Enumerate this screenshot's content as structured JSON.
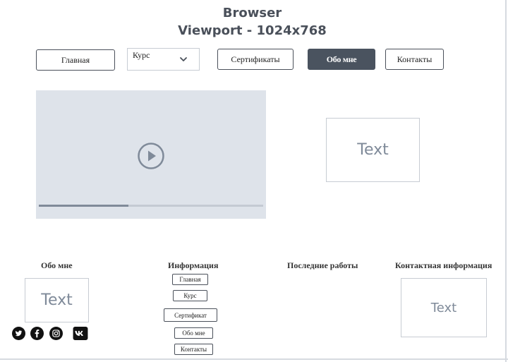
{
  "header": {
    "line1": "Browser",
    "line2": "Viewport - 1024x768"
  },
  "nav": {
    "home": "Главная",
    "course": "Курс",
    "certificates": "Сертификаты",
    "about": "Обо мне",
    "contacts": "Контакты",
    "active": "about"
  },
  "video": {
    "progress": 0.4
  },
  "main_text_box": "Text",
  "footer": {
    "about": {
      "heading": "Обо мне",
      "text_box": "Text",
      "social": [
        "twitter-icon",
        "facebook-icon",
        "instagram-icon",
        "vk-icon"
      ]
    },
    "info": {
      "heading": "Информация",
      "links": [
        "Главная",
        "Курс",
        "Сертификат",
        "Обо мне",
        "Контакты"
      ]
    },
    "recent_work": {
      "heading": "Последние работы"
    },
    "contact_info": {
      "heading": "Контактная информация",
      "text_box": "Text"
    }
  },
  "colors": {
    "accent": "#4a535f",
    "placeholder_bg": "#dee3ea",
    "placeholder_text": "#7f8a99"
  }
}
